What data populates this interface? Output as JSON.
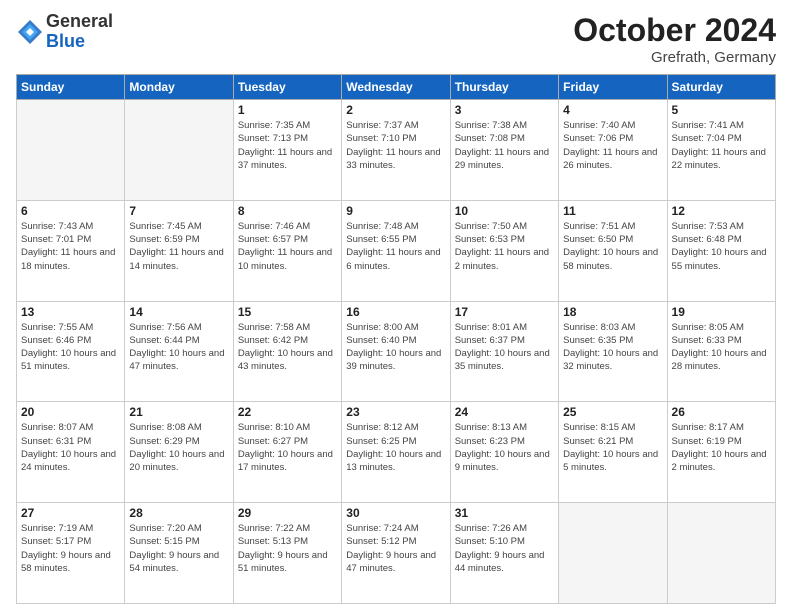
{
  "header": {
    "logo_general": "General",
    "logo_blue": "Blue",
    "month_year": "October 2024",
    "location": "Grefrath, Germany"
  },
  "weekdays": [
    "Sunday",
    "Monday",
    "Tuesday",
    "Wednesday",
    "Thursday",
    "Friday",
    "Saturday"
  ],
  "weeks": [
    [
      {
        "day": "",
        "sunrise": "",
        "sunset": "",
        "daylight": "",
        "empty": true
      },
      {
        "day": "",
        "sunrise": "",
        "sunset": "",
        "daylight": "",
        "empty": true
      },
      {
        "day": "1",
        "sunrise": "Sunrise: 7:35 AM",
        "sunset": "Sunset: 7:13 PM",
        "daylight": "Daylight: 11 hours and 37 minutes.",
        "empty": false
      },
      {
        "day": "2",
        "sunrise": "Sunrise: 7:37 AM",
        "sunset": "Sunset: 7:10 PM",
        "daylight": "Daylight: 11 hours and 33 minutes.",
        "empty": false
      },
      {
        "day": "3",
        "sunrise": "Sunrise: 7:38 AM",
        "sunset": "Sunset: 7:08 PM",
        "daylight": "Daylight: 11 hours and 29 minutes.",
        "empty": false
      },
      {
        "day": "4",
        "sunrise": "Sunrise: 7:40 AM",
        "sunset": "Sunset: 7:06 PM",
        "daylight": "Daylight: 11 hours and 26 minutes.",
        "empty": false
      },
      {
        "day": "5",
        "sunrise": "Sunrise: 7:41 AM",
        "sunset": "Sunset: 7:04 PM",
        "daylight": "Daylight: 11 hours and 22 minutes.",
        "empty": false
      }
    ],
    [
      {
        "day": "6",
        "sunrise": "Sunrise: 7:43 AM",
        "sunset": "Sunset: 7:01 PM",
        "daylight": "Daylight: 11 hours and 18 minutes.",
        "empty": false
      },
      {
        "day": "7",
        "sunrise": "Sunrise: 7:45 AM",
        "sunset": "Sunset: 6:59 PM",
        "daylight": "Daylight: 11 hours and 14 minutes.",
        "empty": false
      },
      {
        "day": "8",
        "sunrise": "Sunrise: 7:46 AM",
        "sunset": "Sunset: 6:57 PM",
        "daylight": "Daylight: 11 hours and 10 minutes.",
        "empty": false
      },
      {
        "day": "9",
        "sunrise": "Sunrise: 7:48 AM",
        "sunset": "Sunset: 6:55 PM",
        "daylight": "Daylight: 11 hours and 6 minutes.",
        "empty": false
      },
      {
        "day": "10",
        "sunrise": "Sunrise: 7:50 AM",
        "sunset": "Sunset: 6:53 PM",
        "daylight": "Daylight: 11 hours and 2 minutes.",
        "empty": false
      },
      {
        "day": "11",
        "sunrise": "Sunrise: 7:51 AM",
        "sunset": "Sunset: 6:50 PM",
        "daylight": "Daylight: 10 hours and 58 minutes.",
        "empty": false
      },
      {
        "day": "12",
        "sunrise": "Sunrise: 7:53 AM",
        "sunset": "Sunset: 6:48 PM",
        "daylight": "Daylight: 10 hours and 55 minutes.",
        "empty": false
      }
    ],
    [
      {
        "day": "13",
        "sunrise": "Sunrise: 7:55 AM",
        "sunset": "Sunset: 6:46 PM",
        "daylight": "Daylight: 10 hours and 51 minutes.",
        "empty": false
      },
      {
        "day": "14",
        "sunrise": "Sunrise: 7:56 AM",
        "sunset": "Sunset: 6:44 PM",
        "daylight": "Daylight: 10 hours and 47 minutes.",
        "empty": false
      },
      {
        "day": "15",
        "sunrise": "Sunrise: 7:58 AM",
        "sunset": "Sunset: 6:42 PM",
        "daylight": "Daylight: 10 hours and 43 minutes.",
        "empty": false
      },
      {
        "day": "16",
        "sunrise": "Sunrise: 8:00 AM",
        "sunset": "Sunset: 6:40 PM",
        "daylight": "Daylight: 10 hours and 39 minutes.",
        "empty": false
      },
      {
        "day": "17",
        "sunrise": "Sunrise: 8:01 AM",
        "sunset": "Sunset: 6:37 PM",
        "daylight": "Daylight: 10 hours and 35 minutes.",
        "empty": false
      },
      {
        "day": "18",
        "sunrise": "Sunrise: 8:03 AM",
        "sunset": "Sunset: 6:35 PM",
        "daylight": "Daylight: 10 hours and 32 minutes.",
        "empty": false
      },
      {
        "day": "19",
        "sunrise": "Sunrise: 8:05 AM",
        "sunset": "Sunset: 6:33 PM",
        "daylight": "Daylight: 10 hours and 28 minutes.",
        "empty": false
      }
    ],
    [
      {
        "day": "20",
        "sunrise": "Sunrise: 8:07 AM",
        "sunset": "Sunset: 6:31 PM",
        "daylight": "Daylight: 10 hours and 24 minutes.",
        "empty": false
      },
      {
        "day": "21",
        "sunrise": "Sunrise: 8:08 AM",
        "sunset": "Sunset: 6:29 PM",
        "daylight": "Daylight: 10 hours and 20 minutes.",
        "empty": false
      },
      {
        "day": "22",
        "sunrise": "Sunrise: 8:10 AM",
        "sunset": "Sunset: 6:27 PM",
        "daylight": "Daylight: 10 hours and 17 minutes.",
        "empty": false
      },
      {
        "day": "23",
        "sunrise": "Sunrise: 8:12 AM",
        "sunset": "Sunset: 6:25 PM",
        "daylight": "Daylight: 10 hours and 13 minutes.",
        "empty": false
      },
      {
        "day": "24",
        "sunrise": "Sunrise: 8:13 AM",
        "sunset": "Sunset: 6:23 PM",
        "daylight": "Daylight: 10 hours and 9 minutes.",
        "empty": false
      },
      {
        "day": "25",
        "sunrise": "Sunrise: 8:15 AM",
        "sunset": "Sunset: 6:21 PM",
        "daylight": "Daylight: 10 hours and 5 minutes.",
        "empty": false
      },
      {
        "day": "26",
        "sunrise": "Sunrise: 8:17 AM",
        "sunset": "Sunset: 6:19 PM",
        "daylight": "Daylight: 10 hours and 2 minutes.",
        "empty": false
      }
    ],
    [
      {
        "day": "27",
        "sunrise": "Sunrise: 7:19 AM",
        "sunset": "Sunset: 5:17 PM",
        "daylight": "Daylight: 9 hours and 58 minutes.",
        "empty": false
      },
      {
        "day": "28",
        "sunrise": "Sunrise: 7:20 AM",
        "sunset": "Sunset: 5:15 PM",
        "daylight": "Daylight: 9 hours and 54 minutes.",
        "empty": false
      },
      {
        "day": "29",
        "sunrise": "Sunrise: 7:22 AM",
        "sunset": "Sunset: 5:13 PM",
        "daylight": "Daylight: 9 hours and 51 minutes.",
        "empty": false
      },
      {
        "day": "30",
        "sunrise": "Sunrise: 7:24 AM",
        "sunset": "Sunset: 5:12 PM",
        "daylight": "Daylight: 9 hours and 47 minutes.",
        "empty": false
      },
      {
        "day": "31",
        "sunrise": "Sunrise: 7:26 AM",
        "sunset": "Sunset: 5:10 PM",
        "daylight": "Daylight: 9 hours and 44 minutes.",
        "empty": false
      },
      {
        "day": "",
        "sunrise": "",
        "sunset": "",
        "daylight": "",
        "empty": true
      },
      {
        "day": "",
        "sunrise": "",
        "sunset": "",
        "daylight": "",
        "empty": true
      }
    ]
  ]
}
